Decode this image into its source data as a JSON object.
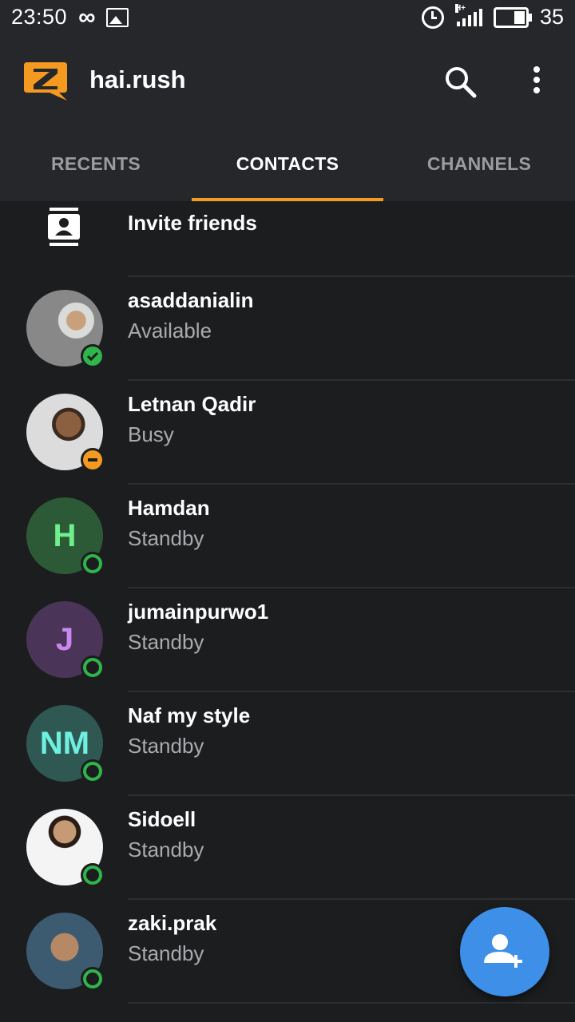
{
  "status_bar": {
    "time": "23:50",
    "battery": "35",
    "signal_label": "H+",
    "icons": [
      "infinity-icon",
      "image-icon",
      "alarm-icon",
      "signal-icon",
      "battery-icon"
    ]
  },
  "app_bar": {
    "title": "hai.rush",
    "logo_letter": "Z",
    "icons": [
      "search-icon",
      "more-vert-icon"
    ]
  },
  "tabs": [
    {
      "label": "RECENTS",
      "active": false
    },
    {
      "label": "CONTACTS",
      "active": true
    },
    {
      "label": "CHANNELS",
      "active": false
    }
  ],
  "invite": {
    "label": "Invite friends"
  },
  "contacts": [
    {
      "name": "asaddanialin",
      "status": "Available",
      "initials": "",
      "status_type": "available"
    },
    {
      "name": "Letnan Qadir",
      "status": "Busy",
      "initials": "",
      "status_type": "busy"
    },
    {
      "name": "Hamdan",
      "status": "Standby",
      "initials": "H",
      "status_type": "standby"
    },
    {
      "name": "jumainpurwo1",
      "status": "Standby",
      "initials": "J",
      "status_type": "standby"
    },
    {
      "name": "Naf my style",
      "status": "Standby",
      "initials": "NM",
      "status_type": "standby"
    },
    {
      "name": "Sidoell",
      "status": "Standby",
      "initials": "",
      "status_type": "standby"
    },
    {
      "name": "zaki.prak",
      "status": "Standby",
      "initials": "",
      "status_type": "standby"
    }
  ],
  "colors": {
    "accent": "#f49a20",
    "fab": "#3d8fe8",
    "available": "#2fb54a",
    "busy": "#f49a20",
    "standby": "#2fb54a"
  }
}
